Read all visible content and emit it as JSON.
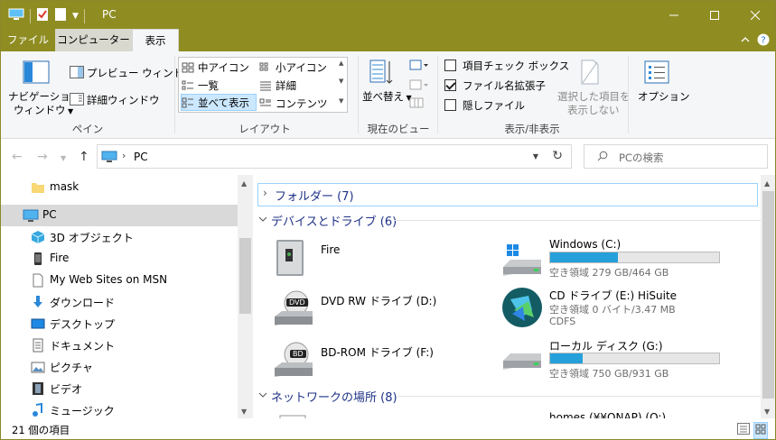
{
  "titlebar": {
    "title": "PC",
    "accent_color": "#8f8d22"
  },
  "tabs": {
    "file": "ファイル",
    "computer": "コンピューター",
    "view": "表示"
  },
  "ribbon": {
    "pane": {
      "nav_pane_line1": "ナビゲーション",
      "nav_pane_line2": "ウィンドウ",
      "preview": "プレビュー ウィンドウ",
      "details": "詳細ウィンドウ",
      "label": "ペイン"
    },
    "layout": {
      "items": [
        "中アイコン",
        "小アイコン",
        "一覧",
        "詳細",
        "並べて表示",
        "コンテンツ"
      ],
      "selected": "並べて表示",
      "label": "レイアウト"
    },
    "current_view": {
      "sort": "並べ替え",
      "label": "現在のビュー"
    },
    "show_hide": {
      "item_checkbox": "項目チェック ボックス",
      "file_ext": "ファイル名拡張子",
      "hidden_items": "隠しファイル",
      "hide_selected_line1": "選択した項目を",
      "hide_selected_line2": "表示しない",
      "label": "表示/非表示",
      "item_checkbox_checked": false,
      "file_ext_checked": true,
      "hidden_items_checked": false
    },
    "options": {
      "label": "オプション"
    }
  },
  "address": {
    "path": "PC",
    "search_placeholder": "PCの検索"
  },
  "nav": {
    "items": [
      {
        "label": "mask",
        "icon": "folder-icon"
      },
      {
        "label": "PC",
        "icon": "pc-icon",
        "selected": true
      },
      {
        "label": "3D オブジェクト",
        "icon": "3d-objects-icon"
      },
      {
        "label": "Fire",
        "icon": "device-icon"
      },
      {
        "label": "My Web Sites on MSN",
        "icon": "web-document-icon"
      },
      {
        "label": "ダウンロード",
        "icon": "download-icon"
      },
      {
        "label": "デスクトップ",
        "icon": "desktop-icon"
      },
      {
        "label": "ドキュメント",
        "icon": "documents-icon"
      },
      {
        "label": "ピクチャ",
        "icon": "pictures-icon"
      },
      {
        "label": "ビデオ",
        "icon": "videos-icon"
      },
      {
        "label": "ミュージック",
        "icon": "music-icon"
      }
    ]
  },
  "content": {
    "folders_header": "フォルダー (7)",
    "devices_header": "デバイスとドライブ (6)",
    "network_header": "ネットワークの場所 (8)",
    "drives": [
      {
        "name": "Fire",
        "icon": "device-icon"
      },
      {
        "name": "Windows (C:)",
        "free": "空き領域 279 GB/464 GB",
        "used_fraction": 0.4,
        "icon": "windows-drive-icon"
      },
      {
        "name": "DVD RW ドライブ (D:)",
        "icon": "dvd-drive-icon",
        "badge": "DVD"
      },
      {
        "name": "CD ドライブ (E:) HiSuite",
        "free": "空き領域 0 バイト/3.47 MB",
        "fs": "CDFS",
        "icon": "hisuite-icon"
      },
      {
        "name": "BD-ROM ドライブ (F:)",
        "icon": "bd-drive-icon",
        "badge": "BD"
      },
      {
        "name": "ローカル ディスク (G:)",
        "free": "空き領域 750 GB/931 GB",
        "used_fraction": 0.19,
        "icon": "local-disk-icon"
      }
    ],
    "network_partial": "homes (¥¥ONAP) (O:)"
  },
  "status": {
    "count": "21 個の項目"
  }
}
